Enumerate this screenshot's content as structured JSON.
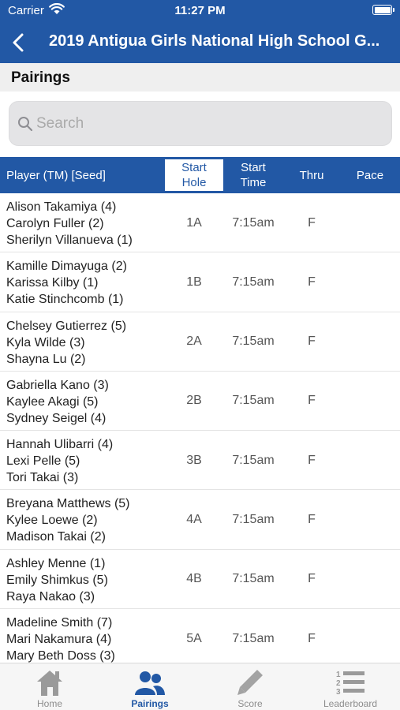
{
  "status": {
    "carrier": "Carrier",
    "time": "11:27 PM"
  },
  "nav": {
    "title": "2019 Antigua Girls National High School G..."
  },
  "section": {
    "title": "Pairings"
  },
  "search": {
    "placeholder": "Search",
    "value": ""
  },
  "table": {
    "headers": {
      "player": "Player (TM) [Seed]",
      "start_hole_line1": "Start",
      "start_hole_line2": "Hole",
      "start_time_line1": "Start",
      "start_time_line2": "Time",
      "thru": "Thru",
      "pace": "Pace"
    },
    "rows": [
      {
        "players": [
          "Alison Takamiya (4)",
          "Carolyn Fuller (2)",
          "Sherilyn Villanueva (1)"
        ],
        "hole": "1A",
        "time": "7:15am",
        "thru": "F",
        "pace": ""
      },
      {
        "players": [
          "Kamille Dimayuga (2)",
          "Karissa Kilby (1)",
          "Katie Stinchcomb (1)"
        ],
        "hole": "1B",
        "time": "7:15am",
        "thru": "F",
        "pace": ""
      },
      {
        "players": [
          "Chelsey Gutierrez (5)",
          "Kyla Wilde (3)",
          "Shayna Lu (2)"
        ],
        "hole": "2A",
        "time": "7:15am",
        "thru": "F",
        "pace": ""
      },
      {
        "players": [
          "Gabriella Kano (3)",
          "Kaylee Akagi (5)",
          "Sydney Seigel (4)"
        ],
        "hole": "2B",
        "time": "7:15am",
        "thru": "F",
        "pace": ""
      },
      {
        "players": [
          "Hannah Ulibarri (4)",
          "Lexi Pelle (5)",
          "Tori Takai (3)"
        ],
        "hole": "3B",
        "time": "7:15am",
        "thru": "F",
        "pace": ""
      },
      {
        "players": [
          "Breyana Matthews (5)",
          "Kylee Loewe (2)",
          "Madison Takai (2)"
        ],
        "hole": "4A",
        "time": "7:15am",
        "thru": "F",
        "pace": ""
      },
      {
        "players": [
          "Ashley Menne (1)",
          "Emily  Shimkus (5)",
          "Raya Nakao (3)"
        ],
        "hole": "4B",
        "time": "7:15am",
        "thru": "F",
        "pace": ""
      },
      {
        "players": [
          "Madeline Smith (7)",
          "Mari Nakamura (4)",
          "Mary Beth Doss (3)"
        ],
        "hole": "5A",
        "time": "7:15am",
        "thru": "F",
        "pace": ""
      }
    ]
  },
  "tabs": [
    {
      "label": "Home",
      "icon": "home-icon",
      "active": false
    },
    {
      "label": "Pairings",
      "icon": "people-icon",
      "active": true
    },
    {
      "label": "Score",
      "icon": "pencil-icon",
      "active": false
    },
    {
      "label": "Leaderboard",
      "icon": "numbered-list-icon",
      "active": false
    }
  ],
  "colors": {
    "brand": "#2258a5",
    "tab_inactive": "#8d8d8d"
  }
}
